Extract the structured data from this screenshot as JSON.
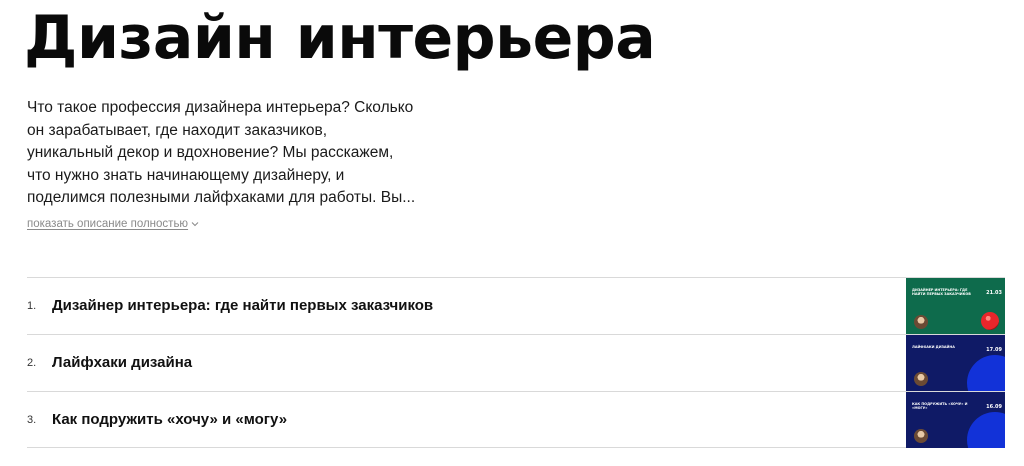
{
  "page": {
    "title": "Дизайн интерьера",
    "description_lines": [
      "Что такое профессия дизайнера интерьера? Сколько",
      "он зарабатывает, где находит заказчиков,",
      "уникальный декор и вдохновение? Мы расскажем,",
      "что нужно знать начинающему дизайнеру, и",
      "поделимся полезными лайфхаками для работы. Вы..."
    ],
    "expand_label": "показать описание полностью"
  },
  "episodes": [
    {
      "number": "1.",
      "title": "Дизайнер интерьера: где найти первых заказчиков",
      "thumbnail": {
        "title": "дизайнер интерьера: где найти первых заказчиков",
        "date": "21.03",
        "theme": "green"
      }
    },
    {
      "number": "2.",
      "title": "Лайфхаки дизайна",
      "thumbnail": {
        "title": "лайфхаки дизайна",
        "date": "17.09",
        "theme": "navy"
      }
    },
    {
      "number": "3.",
      "title": "Как подружить «хочу» и «могу»",
      "thumbnail": {
        "title": "как подружить «хочу» и «могу»",
        "date": "16.09",
        "theme": "navy"
      }
    }
  ],
  "colors": {
    "text": "#111111",
    "muted": "#8a8a8a",
    "divider": "#d9d9d9",
    "thumb_green": "#0e6b4c",
    "thumb_navy": "#0f1a66",
    "thumb_accent": "#1232d8"
  },
  "icons": {
    "expand": "chevron-down-icon"
  }
}
